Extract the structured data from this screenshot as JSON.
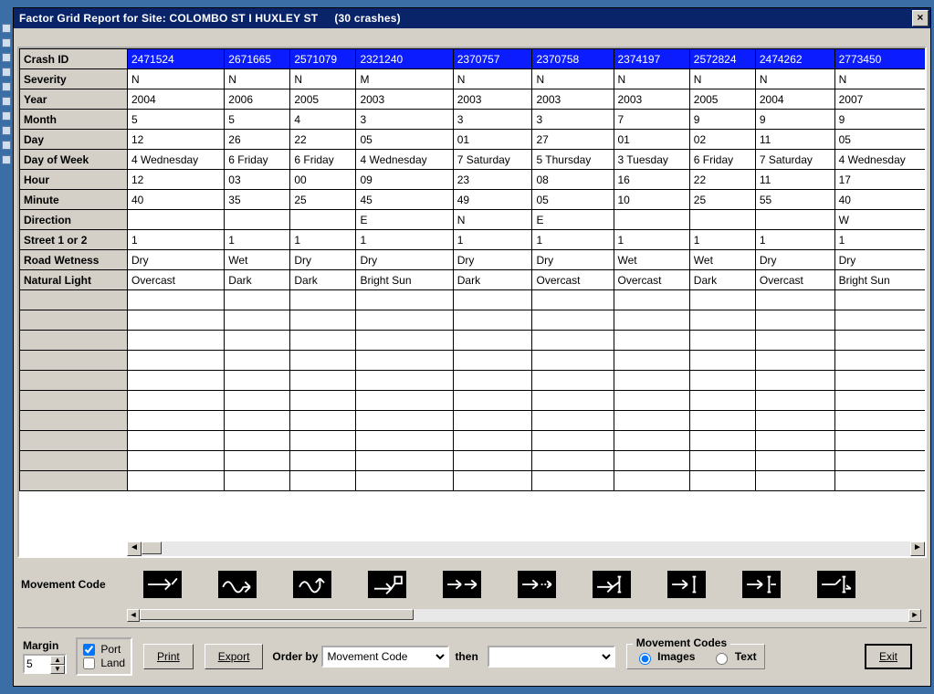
{
  "window": {
    "title_prefix": "Factor Grid Report for Site: ",
    "site": "COLOMBO ST  I  HUXLEY ST",
    "crash_count_label": "(30 crashes)"
  },
  "grid": {
    "row_labels": [
      "Crash ID",
      "Severity",
      "Year",
      "Month",
      "Day",
      "Day of Week",
      "Hour",
      "Minute",
      "Direction",
      "Street 1 or 2",
      "Road Wetness",
      "Natural Light"
    ],
    "crash_ids": [
      "2471524",
      "2671665",
      "2571079",
      "2321240",
      "2370757",
      "2370758",
      "2374197",
      "2572824",
      "2474262",
      "2773450"
    ],
    "rows": {
      "Severity": [
        "N",
        "N",
        "N",
        "M",
        "N",
        "N",
        "N",
        "N",
        "N",
        "N"
      ],
      "Year": [
        "2004",
        "2006",
        "2005",
        "2003",
        "2003",
        "2003",
        "2003",
        "2005",
        "2004",
        "2007"
      ],
      "Month": [
        "5",
        "5",
        "4",
        "3",
        "3",
        "3",
        "7",
        "9",
        "9",
        "9"
      ],
      "Day": [
        "12",
        "26",
        "22",
        "05",
        "01",
        "27",
        "01",
        "02",
        "11",
        "05"
      ],
      "Day of Week": [
        "4 Wednesday",
        "6 Friday",
        "6 Friday",
        "4 Wednesday",
        "7 Saturday",
        "5 Thursday",
        "3 Tuesday",
        "6 Friday",
        "7 Saturday",
        "4 Wednesday"
      ],
      "Hour": [
        "12",
        "03",
        "00",
        "09",
        "23",
        "08",
        "16",
        "22",
        "11",
        "17"
      ],
      "Minute": [
        "40",
        "35",
        "25",
        "45",
        "49",
        "05",
        "10",
        "25",
        "55",
        "40"
      ],
      "Direction": [
        "",
        "",
        "",
        "E",
        "N",
        "E",
        "",
        "",
        "",
        "W"
      ],
      "Street 1 or 2": [
        "1",
        "1",
        "1",
        "1",
        "1",
        "1",
        "1",
        "1",
        "1",
        "1"
      ],
      "Road Wetness": [
        "Dry",
        "Wet",
        "Dry",
        "Dry",
        "Dry",
        "Dry",
        "Wet",
        "Wet",
        "Dry",
        "Dry"
      ],
      "Natural Light": [
        "Overcast",
        "Dark",
        "Dark",
        "Bright Sun",
        "Dark",
        "Overcast",
        "Overcast",
        "Dark",
        "Overcast",
        "Bright Sun"
      ]
    },
    "empty_extra_rows": 10
  },
  "movement_code": {
    "label": "Movement Code",
    "icons": [
      "movement-a",
      "movement-b",
      "movement-c",
      "movement-d",
      "movement-e",
      "movement-f",
      "movement-g",
      "movement-h",
      "movement-i",
      "movement-j"
    ]
  },
  "bottom": {
    "margin_label": "Margin",
    "margin_value": "5",
    "port_label": "Port",
    "land_label": "Land",
    "port_checked": true,
    "land_checked": false,
    "print_label": "Print",
    "export_label": "Export",
    "orderby_label": "Order by",
    "orderby_options": [
      "Movement Code"
    ],
    "orderby_value": "Movement Code",
    "then_label": "then",
    "then_options": [
      ""
    ],
    "then_value": "",
    "mc_group_label": "Movement Codes",
    "mc_images_label": "Images",
    "mc_text_label": "Text",
    "mc_selected": "Images",
    "exit_label": "Exit"
  }
}
